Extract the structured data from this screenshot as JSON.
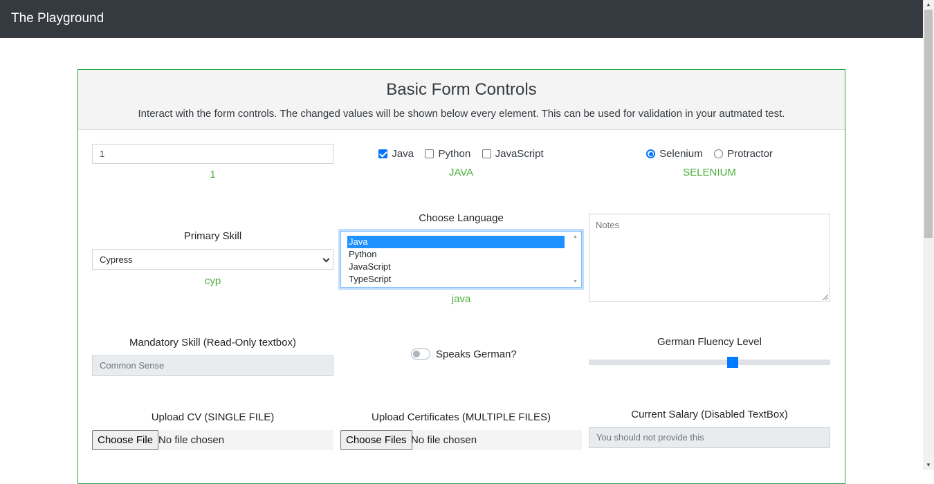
{
  "navbar": {
    "brand": "The Playground"
  },
  "card": {
    "title": "Basic Form Controls",
    "subtitle": "Interact with the form controls. The changed values will be shown below every element. This can be used for validation in your autmated test."
  },
  "number_input": {
    "value": "1",
    "output": "1"
  },
  "languages_checkboxes": {
    "options": [
      {
        "label": "Java",
        "checked": true
      },
      {
        "label": "Python",
        "checked": false
      },
      {
        "label": "JavaScript",
        "checked": false
      }
    ],
    "output": "JAVA"
  },
  "tool_radios": {
    "options": [
      {
        "label": "Selenium",
        "checked": true
      },
      {
        "label": "Protractor",
        "checked": false
      }
    ],
    "output": "SELENIUM"
  },
  "primary_skill": {
    "label": "Primary Skill",
    "value": "Cypress",
    "output": "cyp"
  },
  "choose_language": {
    "label": "Choose Language",
    "options": [
      "Java",
      "Python",
      "JavaScript",
      "TypeScript"
    ],
    "selected": "Java",
    "output": "java"
  },
  "notes": {
    "placeholder": "Notes"
  },
  "mandatory_skill": {
    "label": "Mandatory Skill (Read-Only textbox)",
    "value": "Common Sense"
  },
  "speaks_german": {
    "label": "Speaks German?",
    "checked": false
  },
  "fluency": {
    "label": "German Fluency Level",
    "level_fraction": 0.6
  },
  "upload_cv": {
    "label": "Upload CV (SINGLE FILE)",
    "button": "Choose File",
    "status": "No file chosen"
  },
  "upload_certs": {
    "label": "Upload Certificates (MULTIPLE FILES)",
    "button": "Choose Files",
    "status": "No file chosen"
  },
  "salary": {
    "label": "Current Salary (Disabled TextBox)",
    "placeholder": "You should not provide this"
  },
  "colors": {
    "navbar": "#343a40",
    "card_border": "#28a745",
    "output_text": "#4caf3a",
    "accent": "#007bff"
  },
  "icons": {
    "scroll_up": "triangle-up",
    "scroll_down": "triangle-down",
    "select_chevron": "chevron-down"
  }
}
